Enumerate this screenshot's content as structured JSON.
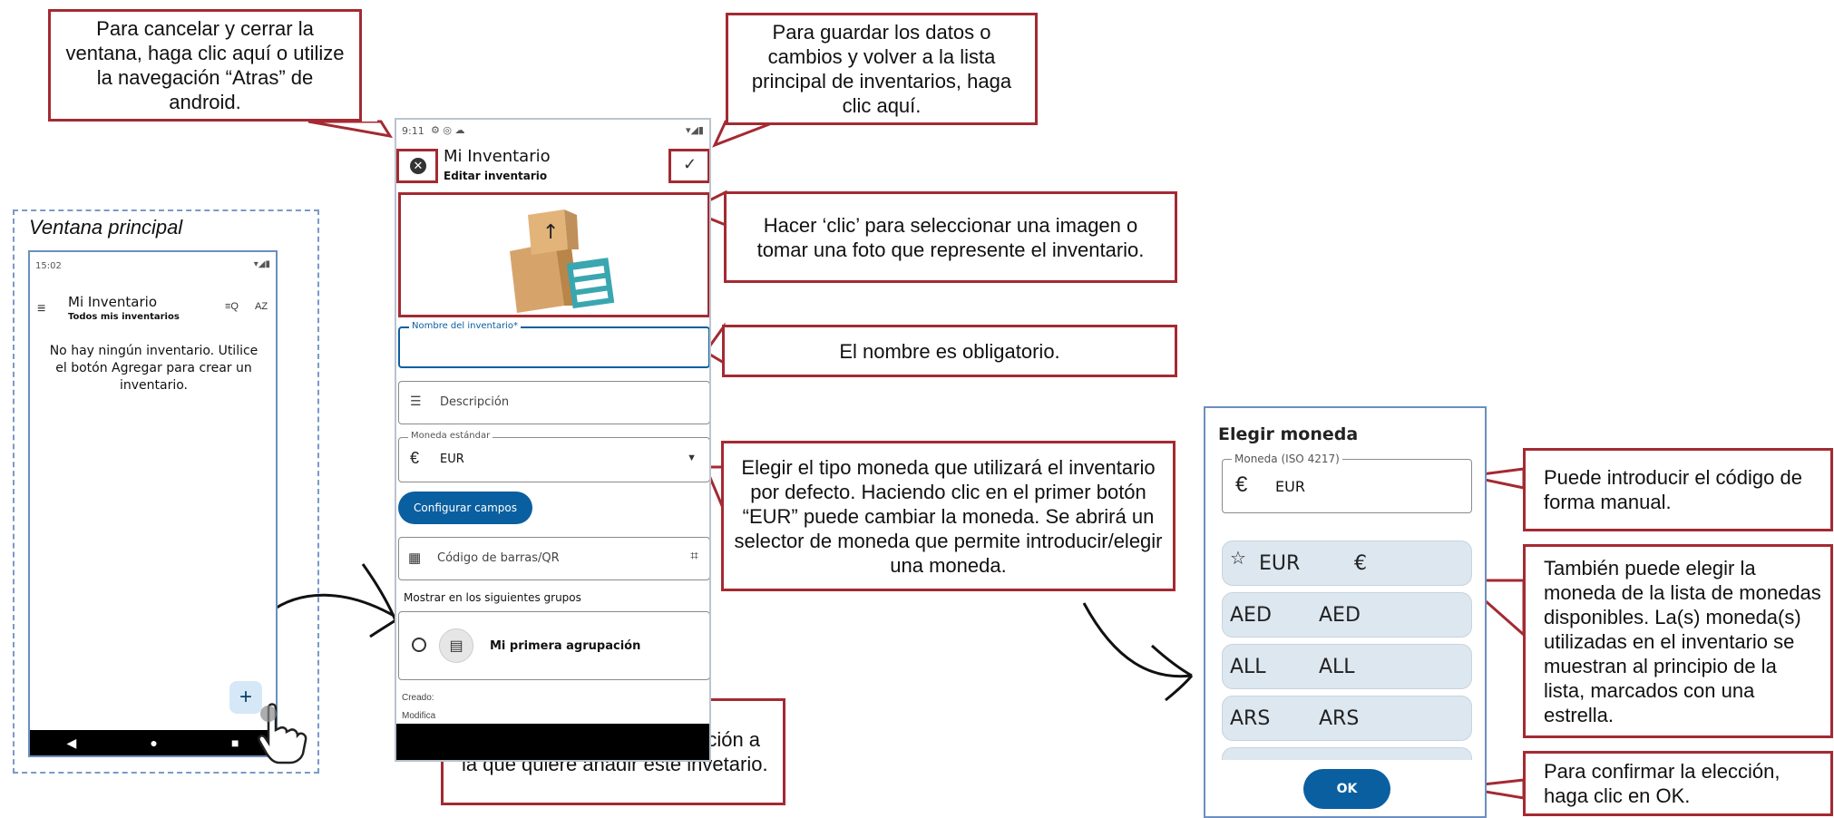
{
  "callouts": {
    "cancel": "Para cancelar y cerrar la ventana, haga clic aquí o utilize la navegación “Atras” de android.",
    "save": "Para guardar los datos o cambios y volver a la lista principal de inventarios, haga clic aquí.",
    "image": "Hacer ‘clic’ para seleccionar una imagen o tomar una foto que represente el inventario.",
    "name": "El nombre es obligatorio.",
    "currency": "Elegir el tipo moneda que utilizará el inventario por defecto. Haciendo clic en el primer botón “EUR” puede cambiar la moneda. Se abrirá un selector de moneda que permite introducir/elegir una moneda.",
    "group": "Aquí puede elegir la agrupación a la que quiere añadir este invetario.",
    "manual_code": "Puede introducir el código de forma manual.",
    "list_choice": "También puede elegir la moneda de la lista de monedas disponibles. La(s) moneda(s) utilizadas en el inventario se muestran al principio de la lista, marcados con una estrella.",
    "confirm": "Para confirmar la elección, haga clic en OK."
  },
  "main_window": {
    "caption": "Ventana principal",
    "status_time": "15:02",
    "title": "Mi Inventario",
    "subtitle": "Todos mis inventarios",
    "sort_label": "AZ",
    "empty_message": "No hay ningún inventario. Utilice el botón Agregar para crear un inventario.",
    "fab": "+"
  },
  "edit_screen": {
    "status_time": "9:11",
    "title": "Mi Inventario",
    "subtitle": "Editar inventario",
    "name_label": "Nombre del inventario*",
    "name_value": "",
    "description_placeholder": "Descripción",
    "currency_label": "Moneda estándar",
    "currency_value": "EUR",
    "configure_button": "Configurar campos",
    "barcode_placeholder": "Código de barras/QR",
    "groups_heading": "Mostrar en los siguientes grupos",
    "group_item": "Mi primera agrupación",
    "created_label": "Creado:",
    "modified_label": "Modifica"
  },
  "currency_dialog": {
    "title": "Elegir moneda",
    "field_label": "Moneda (ISO 4217)",
    "field_value": "EUR",
    "options": [
      {
        "code": "EUR",
        "name": "€",
        "starred": true
      },
      {
        "code": "AED",
        "name": "AED",
        "starred": false
      },
      {
        "code": "ALL",
        "name": "ALL",
        "starred": false
      },
      {
        "code": "ARS",
        "name": "ARS",
        "starred": false
      }
    ],
    "ok_button": "OK"
  },
  "colors": {
    "callout_border": "#a42a32",
    "primary": "#0a5fa0",
    "phone_border": "#6b8fbf",
    "dialog_option_bg": "#dde7ef"
  }
}
